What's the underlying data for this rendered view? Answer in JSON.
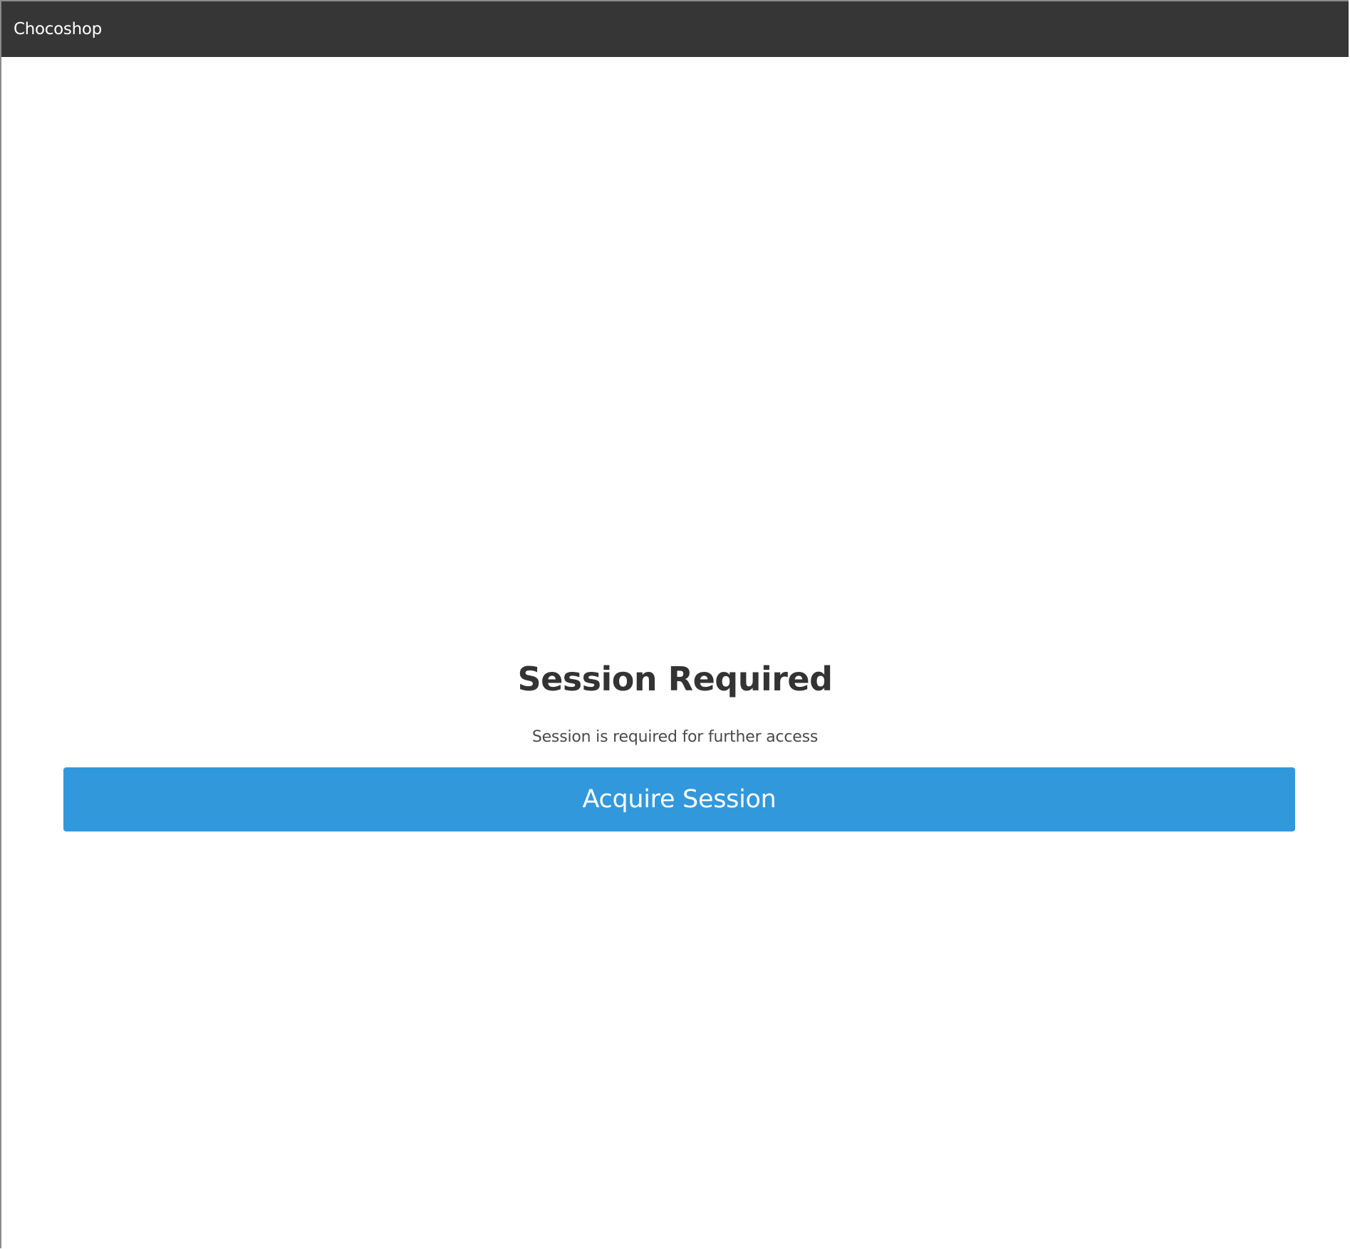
{
  "navbar": {
    "brand": "Chocoshop"
  },
  "session": {
    "title": "Session Required",
    "message": "Session is required for further access",
    "button_label": "Acquire Session"
  },
  "colors": {
    "navbar_bg": "#363636",
    "button_bg": "#3298dc",
    "title_text": "#333333"
  }
}
